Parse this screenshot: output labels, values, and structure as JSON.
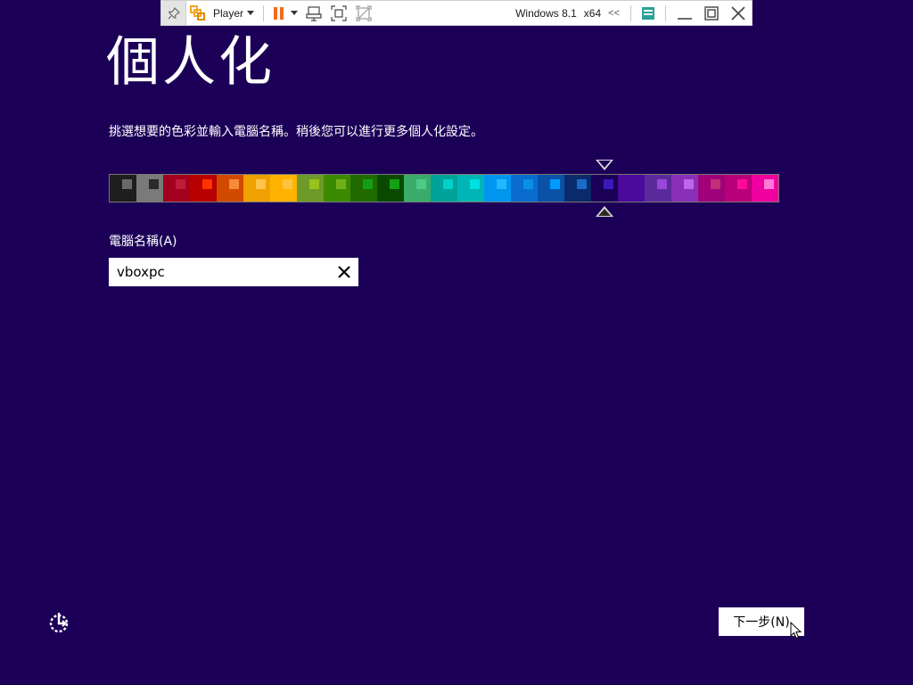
{
  "vm_toolbar": {
    "player_label": "Player",
    "vm_name": "Windows 8.1",
    "vm_arch": "x64",
    "collapse_glyph": "<<",
    "icons": [
      "pin-icon",
      "vmware-logo-icon",
      "pause-icon",
      "send-ctrl-alt-del-icon",
      "fullscreen-icon",
      "unity-icon",
      "removable-devices-icon",
      "minimize-icon",
      "restore-icon",
      "close-icon"
    ],
    "colors": {
      "pause": "#f26b1d",
      "logo": "#f5a623",
      "devices": "#2aa198"
    }
  },
  "page": {
    "title": "個人化",
    "subtitle": "挑選想要的色彩並輸入電腦名稱。稍後您可以進行更多個人化設定。",
    "background": "#1c0058"
  },
  "color_picker": {
    "selected_index": 18,
    "swatches": [
      {
        "bg": "#1e1e1e",
        "chip": "#6a6a6a"
      },
      {
        "bg": "#7a7a7a",
        "chip": "#2a2a2a"
      },
      {
        "bg": "#a3001e",
        "chip": "#c21a3c"
      },
      {
        "bg": "#b80000",
        "chip": "#ff3300"
      },
      {
        "bg": "#d14a00",
        "chip": "#f58a3a"
      },
      {
        "bg": "#f0a000",
        "chip": "#ffc54a"
      },
      {
        "bg": "#ffb300",
        "chip": "#ffc33c"
      },
      {
        "bg": "#6e9a2a",
        "chip": "#96c31c"
      },
      {
        "bg": "#3c8a00",
        "chip": "#72b01a"
      },
      {
        "bg": "#1f6b00",
        "chip": "#12a012"
      },
      {
        "bg": "#0a4a00",
        "chip": "#14a016"
      },
      {
        "bg": "#3aab6a",
        "chip": "#4ec98c"
      },
      {
        "bg": "#00a39a",
        "chip": "#00d0c8"
      },
      {
        "bg": "#00b5b5",
        "chip": "#00e1e1"
      },
      {
        "bg": "#0096f0",
        "chip": "#22b8ff"
      },
      {
        "bg": "#0a6ccd",
        "chip": "#0a90e6"
      },
      {
        "bg": "#0a52a8",
        "chip": "#009bff"
      },
      {
        "bg": "#0a2a6a",
        "chip": "#1a6ac9"
      },
      {
        "bg": "#1c0058",
        "chip": "#3a1bb8"
      },
      {
        "bg": "#4b0a9a",
        "chip": "#4b0a9a"
      },
      {
        "bg": "#5b2a9a",
        "chip": "#9a46d8"
      },
      {
        "bg": "#8a30b8",
        "chip": "#c067e8"
      },
      {
        "bg": "#a0007a",
        "chip": "#c0307a"
      },
      {
        "bg": "#b8007a",
        "chip": "#ff0a9a"
      },
      {
        "bg": "#f000a0",
        "chip": "#ff78d8"
      }
    ]
  },
  "pc_name": {
    "label": "電腦名稱(A)",
    "value": "vboxpc",
    "clear_icon": "close-icon"
  },
  "footer": {
    "ease_of_access_icon": "ease-of-access-icon",
    "next_label": "下一步(N)"
  }
}
